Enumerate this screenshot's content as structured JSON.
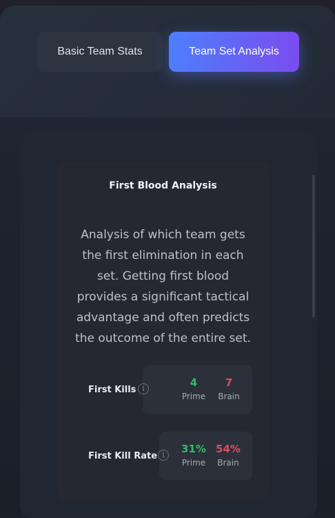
{
  "tabs": {
    "basic_label": "Basic Team Stats",
    "team_label": "Team Set Analysis",
    "active": "Team Set Analysis"
  },
  "card": {
    "title": "First Blood Analysis",
    "description": "Analysis of which team gets the first elimination in each set. Getting first blood provides a significant tactical advantage and often predicts the outcome of the entire set."
  },
  "stats": {
    "first_kills": {
      "label": "First Kills",
      "prime_value": "4",
      "prime_label": "Prime",
      "brain_value": "7",
      "brain_label": "Brain"
    },
    "first_kill_rate": {
      "label": "First Kill Rate",
      "prime_value": "31%",
      "prime_label": "Prime",
      "brain_value": "54%",
      "brain_label": "Brain"
    }
  },
  "icons": {
    "info": "info-icon"
  },
  "colors": {
    "accent_start": "#4d7ffa",
    "accent_end": "#7a4cf0",
    "prime_color": "#2fbf63",
    "brain_color": "#e04c5c"
  }
}
